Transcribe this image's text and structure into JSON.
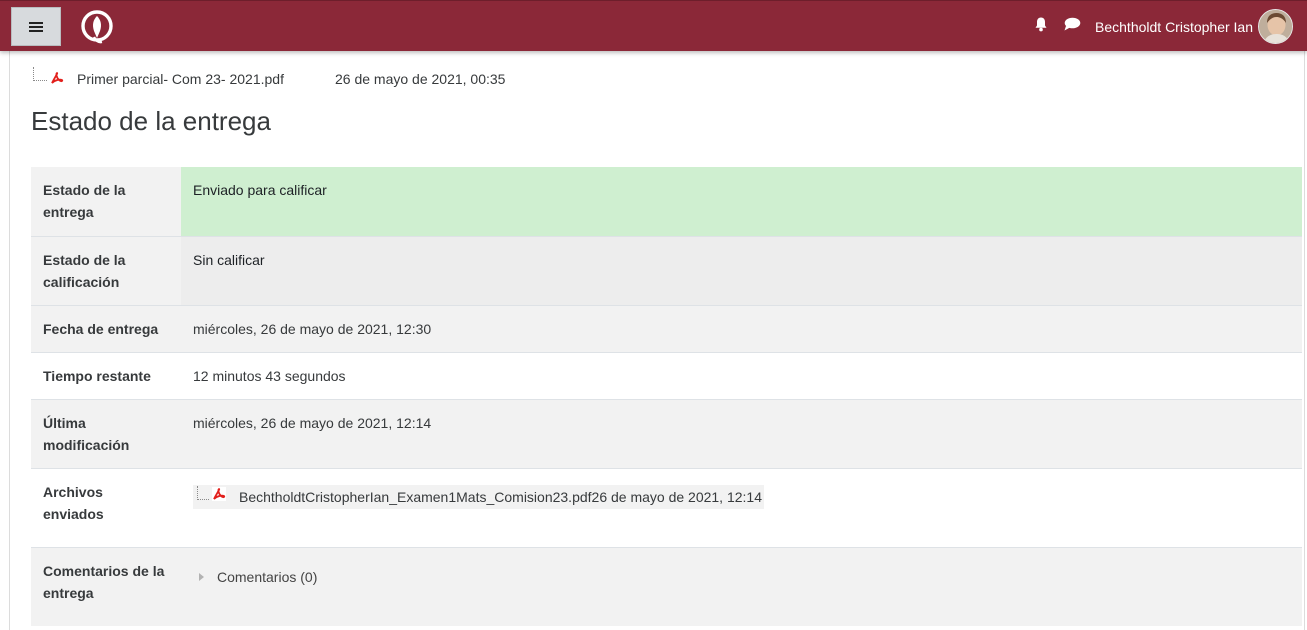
{
  "navbar": {
    "menu_icon": "hamburger-icon",
    "logo_icon": "university-logo",
    "notifications_icon": "bell-icon",
    "messages_icon": "chat-bubble-icon",
    "user_name": "Bechtholdt Cristopher Ian",
    "brand_color": "#8b2838"
  },
  "intro_file": {
    "icon": "pdf-icon",
    "name": "Primer parcial- Com 23- 2021.pdf",
    "date": "26 de mayo de 2021, 00:35"
  },
  "section_title": "Estado de la entrega",
  "status_table": {
    "submission_status": {
      "label_line1": "Estado de la",
      "label_line2": "entrega",
      "value": "Enviado para calificar",
      "color": "#cfefd0"
    },
    "grading_status": {
      "label_line1": "Estado de la",
      "label_line2": "calificación",
      "value": "Sin calificar"
    },
    "due_date": {
      "label": "Fecha de entrega",
      "value": "miércoles, 26 de mayo de 2021, 12:30"
    },
    "time_remaining": {
      "label": "Tiempo restante",
      "value": "12 minutos 43 segundos"
    },
    "last_modified": {
      "label_line1": "Última",
      "label_line2": "modificación",
      "value": "miércoles, 26 de mayo de 2021, 12:14"
    },
    "submitted_files": {
      "label_line1": "Archivos",
      "label_line2": "enviados",
      "file_name": "BechtholdtCristopherIan_Examen1Mats_Comision23.pdf",
      "file_date": "26 de mayo de 2021, 12:14"
    },
    "submission_comments": {
      "label_line1": "Comentarios de la",
      "label_line2": "entrega",
      "link": "Comentarios (0)"
    }
  }
}
